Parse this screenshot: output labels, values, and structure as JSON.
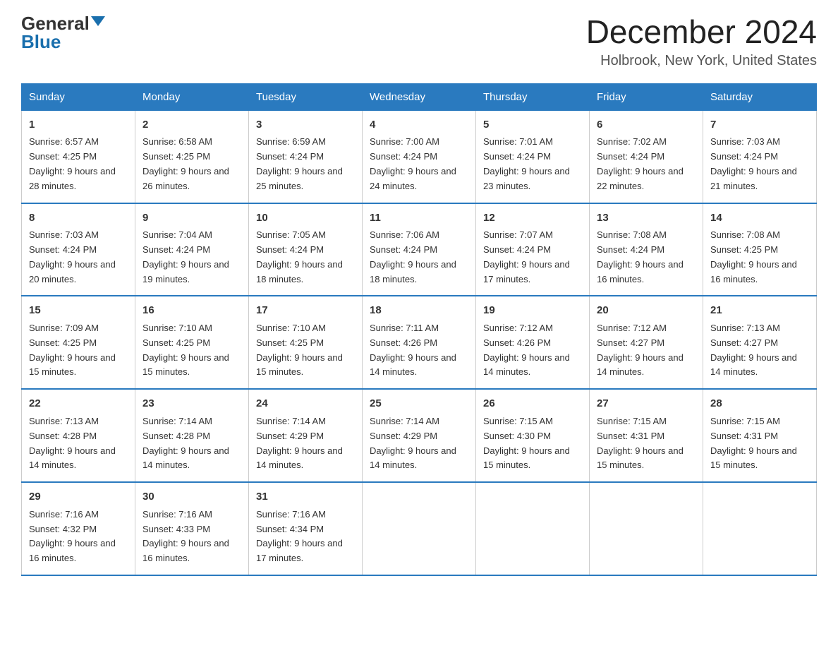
{
  "header": {
    "logo_general": "General",
    "logo_blue": "Blue",
    "title": "December 2024",
    "subtitle": "Holbrook, New York, United States"
  },
  "days_of_week": [
    "Sunday",
    "Monday",
    "Tuesday",
    "Wednesday",
    "Thursday",
    "Friday",
    "Saturday"
  ],
  "weeks": [
    [
      {
        "day": "1",
        "sunrise": "6:57 AM",
        "sunset": "4:25 PM",
        "daylight": "9 hours and 28 minutes."
      },
      {
        "day": "2",
        "sunrise": "6:58 AM",
        "sunset": "4:25 PM",
        "daylight": "9 hours and 26 minutes."
      },
      {
        "day": "3",
        "sunrise": "6:59 AM",
        "sunset": "4:24 PM",
        "daylight": "9 hours and 25 minutes."
      },
      {
        "day": "4",
        "sunrise": "7:00 AM",
        "sunset": "4:24 PM",
        "daylight": "9 hours and 24 minutes."
      },
      {
        "day": "5",
        "sunrise": "7:01 AM",
        "sunset": "4:24 PM",
        "daylight": "9 hours and 23 minutes."
      },
      {
        "day": "6",
        "sunrise": "7:02 AM",
        "sunset": "4:24 PM",
        "daylight": "9 hours and 22 minutes."
      },
      {
        "day": "7",
        "sunrise": "7:03 AM",
        "sunset": "4:24 PM",
        "daylight": "9 hours and 21 minutes."
      }
    ],
    [
      {
        "day": "8",
        "sunrise": "7:03 AM",
        "sunset": "4:24 PM",
        "daylight": "9 hours and 20 minutes."
      },
      {
        "day": "9",
        "sunrise": "7:04 AM",
        "sunset": "4:24 PM",
        "daylight": "9 hours and 19 minutes."
      },
      {
        "day": "10",
        "sunrise": "7:05 AM",
        "sunset": "4:24 PM",
        "daylight": "9 hours and 18 minutes."
      },
      {
        "day": "11",
        "sunrise": "7:06 AM",
        "sunset": "4:24 PM",
        "daylight": "9 hours and 18 minutes."
      },
      {
        "day": "12",
        "sunrise": "7:07 AM",
        "sunset": "4:24 PM",
        "daylight": "9 hours and 17 minutes."
      },
      {
        "day": "13",
        "sunrise": "7:08 AM",
        "sunset": "4:24 PM",
        "daylight": "9 hours and 16 minutes."
      },
      {
        "day": "14",
        "sunrise": "7:08 AM",
        "sunset": "4:25 PM",
        "daylight": "9 hours and 16 minutes."
      }
    ],
    [
      {
        "day": "15",
        "sunrise": "7:09 AM",
        "sunset": "4:25 PM",
        "daylight": "9 hours and 15 minutes."
      },
      {
        "day": "16",
        "sunrise": "7:10 AM",
        "sunset": "4:25 PM",
        "daylight": "9 hours and 15 minutes."
      },
      {
        "day": "17",
        "sunrise": "7:10 AM",
        "sunset": "4:25 PM",
        "daylight": "9 hours and 15 minutes."
      },
      {
        "day": "18",
        "sunrise": "7:11 AM",
        "sunset": "4:26 PM",
        "daylight": "9 hours and 14 minutes."
      },
      {
        "day": "19",
        "sunrise": "7:12 AM",
        "sunset": "4:26 PM",
        "daylight": "9 hours and 14 minutes."
      },
      {
        "day": "20",
        "sunrise": "7:12 AM",
        "sunset": "4:27 PM",
        "daylight": "9 hours and 14 minutes."
      },
      {
        "day": "21",
        "sunrise": "7:13 AM",
        "sunset": "4:27 PM",
        "daylight": "9 hours and 14 minutes."
      }
    ],
    [
      {
        "day": "22",
        "sunrise": "7:13 AM",
        "sunset": "4:28 PM",
        "daylight": "9 hours and 14 minutes."
      },
      {
        "day": "23",
        "sunrise": "7:14 AM",
        "sunset": "4:28 PM",
        "daylight": "9 hours and 14 minutes."
      },
      {
        "day": "24",
        "sunrise": "7:14 AM",
        "sunset": "4:29 PM",
        "daylight": "9 hours and 14 minutes."
      },
      {
        "day": "25",
        "sunrise": "7:14 AM",
        "sunset": "4:29 PM",
        "daylight": "9 hours and 14 minutes."
      },
      {
        "day": "26",
        "sunrise": "7:15 AM",
        "sunset": "4:30 PM",
        "daylight": "9 hours and 15 minutes."
      },
      {
        "day": "27",
        "sunrise": "7:15 AM",
        "sunset": "4:31 PM",
        "daylight": "9 hours and 15 minutes."
      },
      {
        "day": "28",
        "sunrise": "7:15 AM",
        "sunset": "4:31 PM",
        "daylight": "9 hours and 15 minutes."
      }
    ],
    [
      {
        "day": "29",
        "sunrise": "7:16 AM",
        "sunset": "4:32 PM",
        "daylight": "9 hours and 16 minutes."
      },
      {
        "day": "30",
        "sunrise": "7:16 AM",
        "sunset": "4:33 PM",
        "daylight": "9 hours and 16 minutes."
      },
      {
        "day": "31",
        "sunrise": "7:16 AM",
        "sunset": "4:34 PM",
        "daylight": "9 hours and 17 minutes."
      },
      {
        "day": "",
        "sunrise": "",
        "sunset": "",
        "daylight": ""
      },
      {
        "day": "",
        "sunrise": "",
        "sunset": "",
        "daylight": ""
      },
      {
        "day": "",
        "sunrise": "",
        "sunset": "",
        "daylight": ""
      },
      {
        "day": "",
        "sunrise": "",
        "sunset": "",
        "daylight": ""
      }
    ]
  ],
  "labels": {
    "sunrise": "Sunrise:",
    "sunset": "Sunset:",
    "daylight": "Daylight:"
  }
}
